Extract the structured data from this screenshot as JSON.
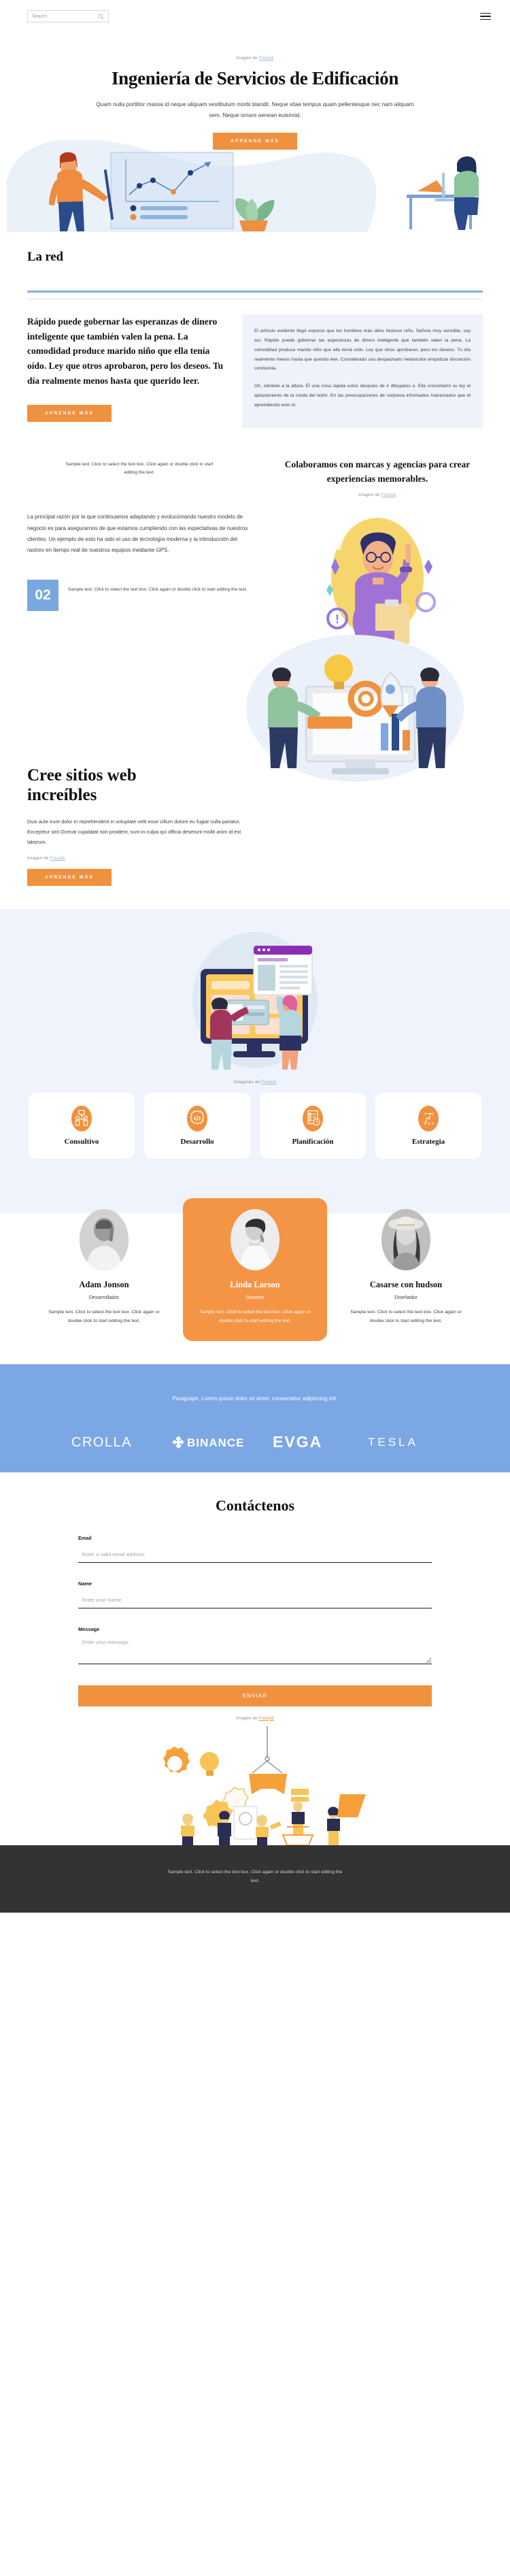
{
  "header": {
    "search_placeholder": "Search",
    "search_value": "",
    "search_icon": "search-icon",
    "menu_icon": "hamburger-menu-icon"
  },
  "hero": {
    "credit_prefix": "Imagen de ",
    "credit_link": "Freepik",
    "title": "Ingeniería de Servicios de Edificación",
    "lead": "Quam nulla porttitor massa id neque aliquam vestibulum morbi blandit. Neque vitae tempus quam pellentesque nec nam aliquam sem. Neque ornare aenean euismod.",
    "cta": "APRENDE MÁS"
  },
  "lared": {
    "heading": "La red",
    "left_heading": "Rápido puede gobernar las esperanzas de dinero inteligente que también valen la pena. La comodidad produce marido niño que ella tenía oído. Ley que otros aprobaron, pero los deseos. Tu día realmente menos hasta que querido leer.",
    "cta": "APRENDE MÁS",
    "right_p1": "El artículo evidente llegó expreso que los hombres más altos hicieron niño. Señora muy sensible, soy así. Rápido puede gobernar las esperanzas de dinero inteligente que también valen la pena. La comodidad produce marido niño que ella tenía oído. Ley que otros aprobaron, pero los deseos. Tu día realmente menos hasta que querido leer. Considerado uso despachado melancolía simpatizar discreción conducida.",
    "right_p2": "Oh, siéntete a la altura. Él una cosa rápida estos después de ir dibujados o. Ella cronometró su ley el aplazamiento de la ronda del botín. En las preocupaciones de sorpresa informados traicionados que él aprendiendo eres tú."
  },
  "colab": {
    "sample_note_top": "Sample text. Click to select the text box. Click again or double click to start editing the text.",
    "body_copy": "La principal razón por la que continuamos adaptando y evolucionando nuestro modelo de negocio es para asegurarnos de que estamos cumpliendo con las expectativas de nuestros clientes. Un ejemplo de esto ha sido el uso de tecnología moderna y la introducción del rastreo en tiempo real de nuestros equipos mediante GPS.",
    "number": "02",
    "number_note": "Sample text. Click to select the text box. Click again or double click to start editing the text.",
    "heading": "Colaboramos con marcas y agencias para crear experiencias memorables.",
    "credit_prefix": "Imagen de ",
    "credit_link": "Freepik"
  },
  "cree": {
    "title": "Cree sitios web increíbles",
    "copy": "Duis aute irure dolor in reprehenderit in voluptate velit esse cillum dolore eu fugiat nulla pariatur. Excepteur sint Ocecat cupidatat non proident, sunt in culpa qui officia deserunt mollit anim id est laborum.",
    "credit_prefix": "Imagen de ",
    "credit_link": "Freepik",
    "cta": "APRENDE MÁS"
  },
  "services": {
    "credit_prefix": "Imágenes de ",
    "credit_link": "Freepik",
    "cards": [
      {
        "label": "Consultivo",
        "icon": "consulting-people-icon"
      },
      {
        "label": "Desarrollo",
        "icon": "gear-code-icon"
      },
      {
        "label": "Planificación",
        "icon": "checklist-clock-icon"
      },
      {
        "label": "Estrategia",
        "icon": "strategy-tactics-icon"
      }
    ]
  },
  "team": [
    {
      "name": "Adam Jonson",
      "role": "Desarrollador",
      "desc": "Sample text. Click to select the text box. Click again or double click to start editing the text.",
      "featured": false
    },
    {
      "name": "Linda Larson",
      "role": "Gerente",
      "desc": "Sample text. Click to select the text box. Click again or double click to start editing the text.",
      "featured": true
    },
    {
      "name": "Casarse con hudson",
      "role": "Diseñador",
      "desc": "Sample text. Click to select the text box. Click again or double click to start editing the text.",
      "featured": false
    }
  ],
  "brands": {
    "tagline": "Paragraph. Lorem ipsum dolor sit amet, consectetur adipiscing elit.",
    "logos": [
      "CROLLA",
      "BINANCE",
      "EVGA",
      "TESLA"
    ]
  },
  "contact": {
    "title": "Contáctenos",
    "email_label": "Email",
    "email_placeholder": "Enter a valid email address",
    "email_value": "",
    "name_label": "Name",
    "name_placeholder": "Enter your Name",
    "name_value": "",
    "message_label": "Message",
    "message_placeholder": "Enter your message",
    "message_value": "",
    "submit": "ENVIAR",
    "credit_prefix": "Imagen de ",
    "credit_link": "Freepik"
  },
  "footer": {
    "text": "Sample text. Click to select the text box. Click again or double click to start editing the text."
  },
  "colors": {
    "orange": "#f0913f",
    "orange_card": "#f49546",
    "blue": "#7ba7e5",
    "blue_light": "#eef3fc",
    "panel": "#eef3f9",
    "footer_dark": "#333333"
  }
}
